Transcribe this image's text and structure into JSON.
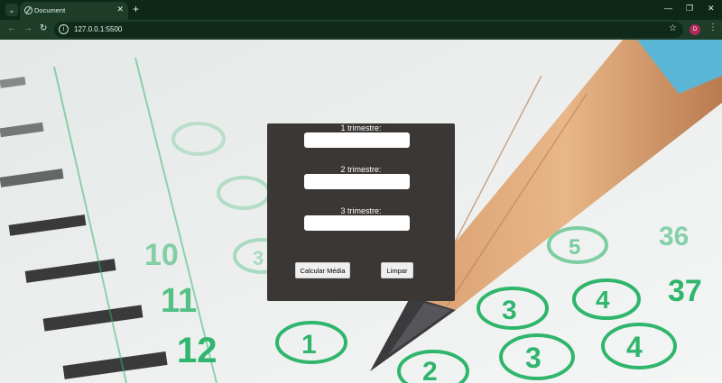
{
  "browser": {
    "tab_title": "Document",
    "url": "127.0.0.1:5500",
    "profile_initial": "D",
    "theme_color": "#1d3d29"
  },
  "form": {
    "label_1": "1 trimestre:",
    "label_2": "2 trimestre:",
    "label_3": "3 trimestre:",
    "value_1": "",
    "value_2": "",
    "value_3": "",
    "calcular_label": "Calcular Média",
    "limpar_label": "Limpar",
    "card_color": "#3a3734"
  },
  "background": {
    "numbers": [
      "10",
      "11",
      "12",
      "1",
      "2",
      "3",
      "4",
      "3",
      "4",
      "5",
      "37",
      "36",
      "3"
    ],
    "accent_color": "#2fb56c"
  }
}
